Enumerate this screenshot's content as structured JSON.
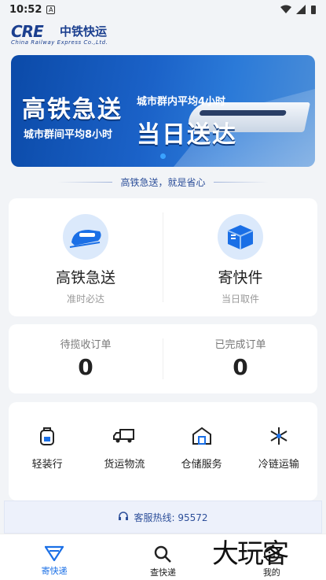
{
  "status": {
    "time": "10:52",
    "notif": "A"
  },
  "logo": {
    "mark": "CRE",
    "cn": "中铁快运",
    "en": "China Railway Express Co.,Ltd."
  },
  "banner": {
    "headline1": "高铁急送",
    "tag_top": "城市群内平均4小时",
    "tag_bottom": "城市群间平均8小时",
    "headline2": "当日送达"
  },
  "slogan": "高铁急送，就是省心",
  "services": [
    {
      "title": "高铁急送",
      "sub": "准时必达",
      "icon": "train-icon"
    },
    {
      "title": "寄快件",
      "sub": "当日取件",
      "icon": "package-icon"
    }
  ],
  "orders": [
    {
      "label": "待揽收订单",
      "count": "0"
    },
    {
      "label": "已完成订单",
      "count": "0"
    }
  ],
  "tools": [
    {
      "label": "轻装行",
      "icon": "backpack-icon"
    },
    {
      "label": "货运物流",
      "icon": "truck-icon"
    },
    {
      "label": "仓储服务",
      "icon": "warehouse-icon"
    },
    {
      "label": "冷链运输",
      "icon": "snowflake-icon"
    }
  ],
  "hotline": "客服热线: 95572",
  "tabs": [
    {
      "label": "寄快递",
      "active": true
    },
    {
      "label": "查快递",
      "active": false
    },
    {
      "label": "我的",
      "active": false
    }
  ],
  "watermark": "大玩客",
  "colors": {
    "primary": "#1a6fe6",
    "brand": "#1b3f8f",
    "bg": "#f2f4f7"
  }
}
